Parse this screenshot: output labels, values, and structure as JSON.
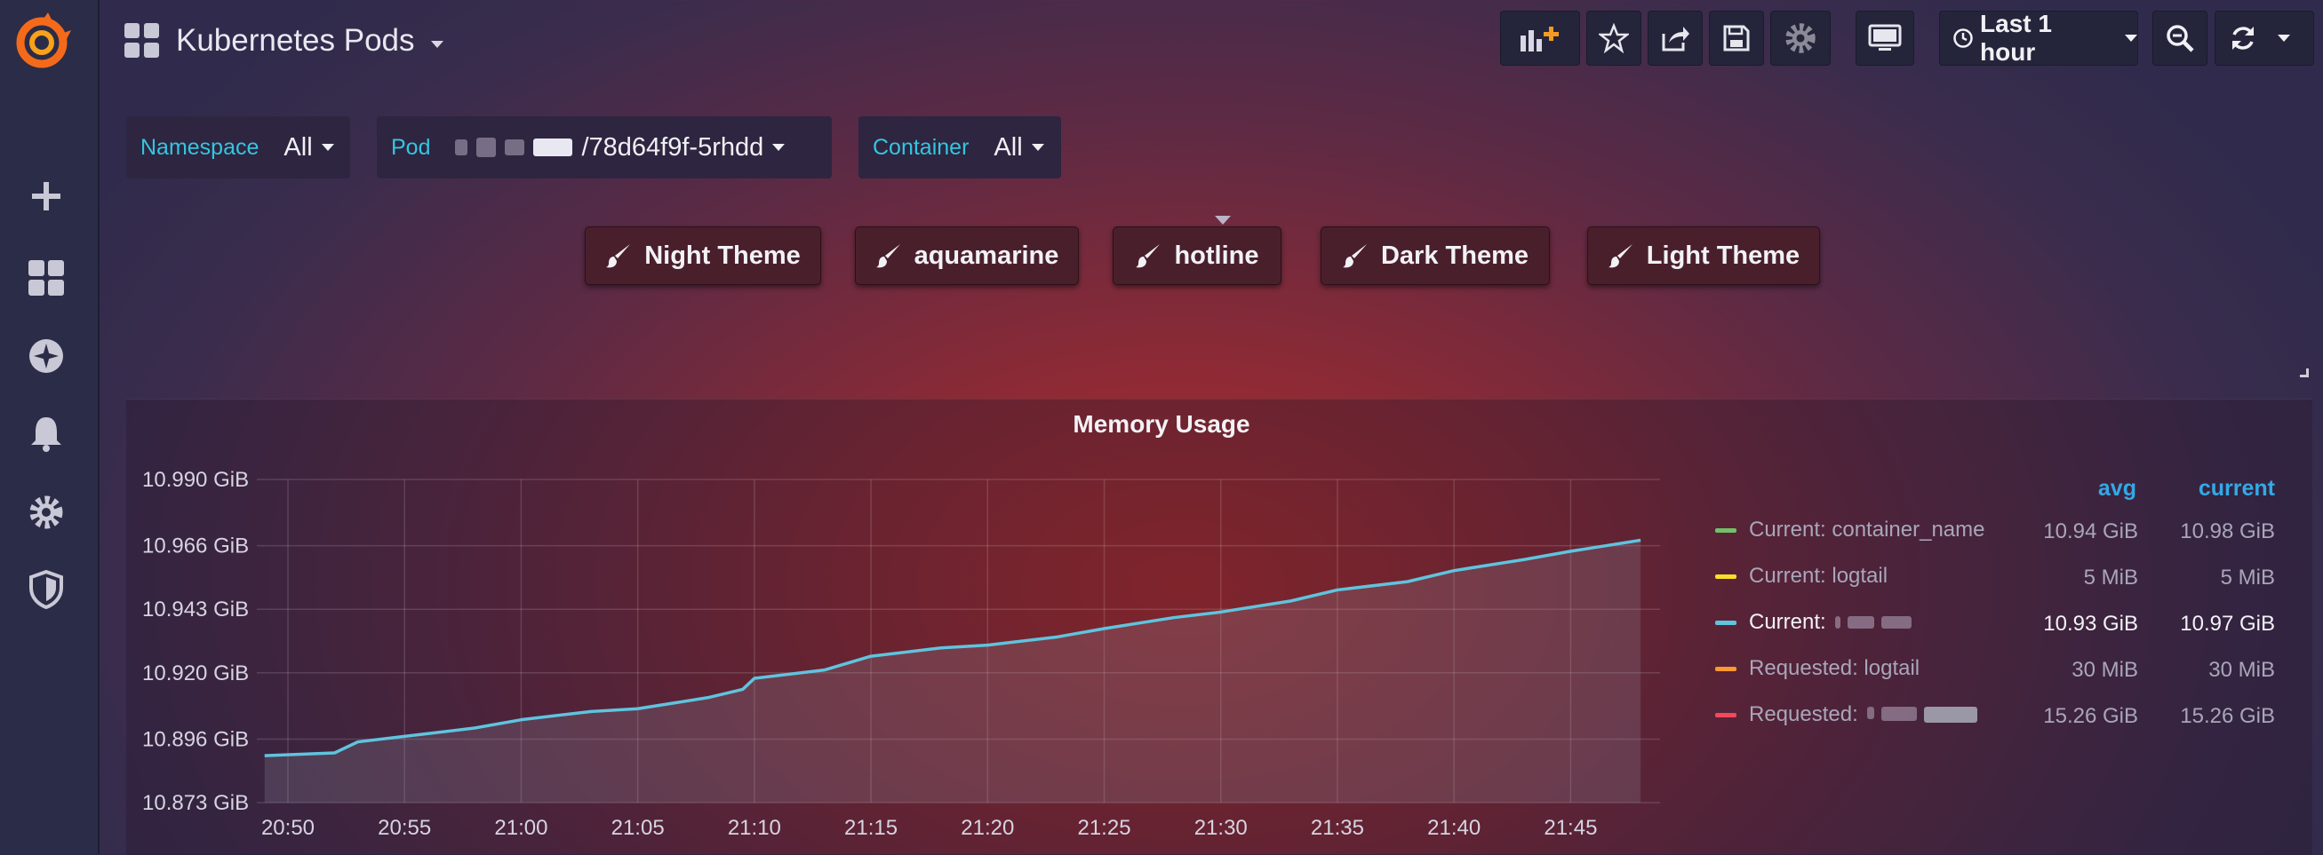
{
  "dashboard": {
    "title": "Kubernetes Pods"
  },
  "toolbar": {
    "time_range": "Last 1 hour"
  },
  "variables": [
    {
      "label": "Namespace",
      "value": "All"
    },
    {
      "label": "Pod",
      "value": "/78d64f9f-5rhdd"
    },
    {
      "label": "Container",
      "value": "All"
    }
  ],
  "themes": [
    "Night Theme",
    "aquamarine",
    "hotline",
    "Dark Theme",
    "Light Theme"
  ],
  "panel": {
    "title": "Memory Usage",
    "legend_headers": {
      "avg": "avg",
      "current": "current"
    },
    "legend": [
      {
        "name": "Current: container_name",
        "color": "#73bf69",
        "avg": "10.94 GiB",
        "current": "10.98 GiB"
      },
      {
        "name": "Current: logtail",
        "color": "#fade2a",
        "avg": "5 MiB",
        "current": "5 MiB"
      },
      {
        "name": "Current:",
        "color": "#5fc4de",
        "avg": "10.93 GiB",
        "current": "10.97 GiB"
      },
      {
        "name": "Requested: logtail",
        "color": "#ff9830",
        "avg": "30 MiB",
        "current": "30 MiB"
      },
      {
        "name": "Requested:",
        "color": "#f2495c",
        "avg": "15.26 GiB",
        "current": "15.26 GiB"
      }
    ]
  },
  "chart_data": {
    "type": "line",
    "title": "Memory Usage",
    "x_ticks": [
      "20:50",
      "20:55",
      "21:00",
      "21:05",
      "21:10",
      "21:15",
      "21:20",
      "21:25",
      "21:30",
      "21:35",
      "21:40",
      "21:45"
    ],
    "y_ticks": [
      "10.990 GiB",
      "10.966 GiB",
      "10.943 GiB",
      "10.920 GiB",
      "10.896 GiB",
      "10.873 GiB"
    ],
    "ylim": [
      10.873,
      10.99
    ],
    "xlim": [
      "20:48:40",
      "21:48:50"
    ],
    "series": [
      {
        "name": "Current:",
        "color": "#5fc4de",
        "x": [
          "20:49",
          "20:52",
          "20:53",
          "20:55",
          "20:58",
          "21:00",
          "21:03",
          "21:05",
          "21:08",
          "21:09:30",
          "21:10",
          "21:13",
          "21:15",
          "21:18",
          "21:20",
          "21:23",
          "21:25",
          "21:28",
          "21:30",
          "21:33",
          "21:35",
          "21:38",
          "21:40",
          "21:43",
          "21:45",
          "21:48"
        ],
        "y": [
          10.89,
          10.891,
          10.895,
          10.897,
          10.9,
          10.903,
          10.906,
          10.907,
          10.911,
          10.914,
          10.918,
          10.921,
          10.926,
          10.929,
          10.93,
          10.933,
          10.936,
          10.94,
          10.942,
          10.946,
          10.95,
          10.953,
          10.957,
          10.961,
          10.964,
          10.968
        ]
      }
    ],
    "grid": true,
    "legend_position": "right"
  }
}
